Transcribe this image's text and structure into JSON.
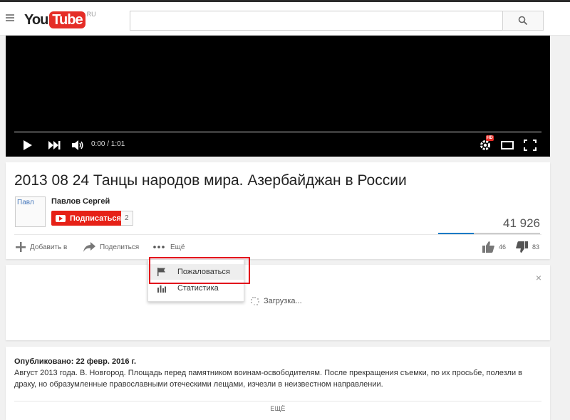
{
  "header": {
    "logo_you": "You",
    "logo_tube": "Tube",
    "logo_region": "RU",
    "search": {
      "value": "",
      "placeholder": ""
    }
  },
  "player": {
    "time": "0:00 / 1:01",
    "hd_badge": "HD"
  },
  "video": {
    "title": "2013 08 24 Танцы народов мира. Азербайджан в России",
    "channel_name": "Павлов Сергей",
    "avatar_alt": "Павл",
    "subscribe_label": "Подписаться",
    "subscriber_count": "2",
    "views": "41 926",
    "like_ratio": 0.35,
    "actions": {
      "add": "Добавить в",
      "share": "Поделиться",
      "more": "Ещё"
    },
    "likes": "46",
    "dislikes": "83"
  },
  "more_menu": {
    "items": [
      {
        "label": "Пожаловаться",
        "icon": "flag-icon"
      },
      {
        "label": "Статистика",
        "icon": "stats-icon"
      }
    ]
  },
  "panel": {
    "loading_text": "Загрузка...",
    "close": "×"
  },
  "description": {
    "published": "Опубликовано: 22 февр. 2016 г.",
    "text": "Август 2013 года. В. Новгород. Площадь перед памятником воинам-освободителям. После прекращения съемки, по их просьбе, полезли в драку, но образумленные православными отеческими лещами, изчезли в неизвестном направлении.",
    "more_label": "ЕЩЁ"
  },
  "colors": {
    "brand_red": "#e62117",
    "highlight_red": "#e2001a",
    "view_bar_blue": "#167ac6"
  }
}
